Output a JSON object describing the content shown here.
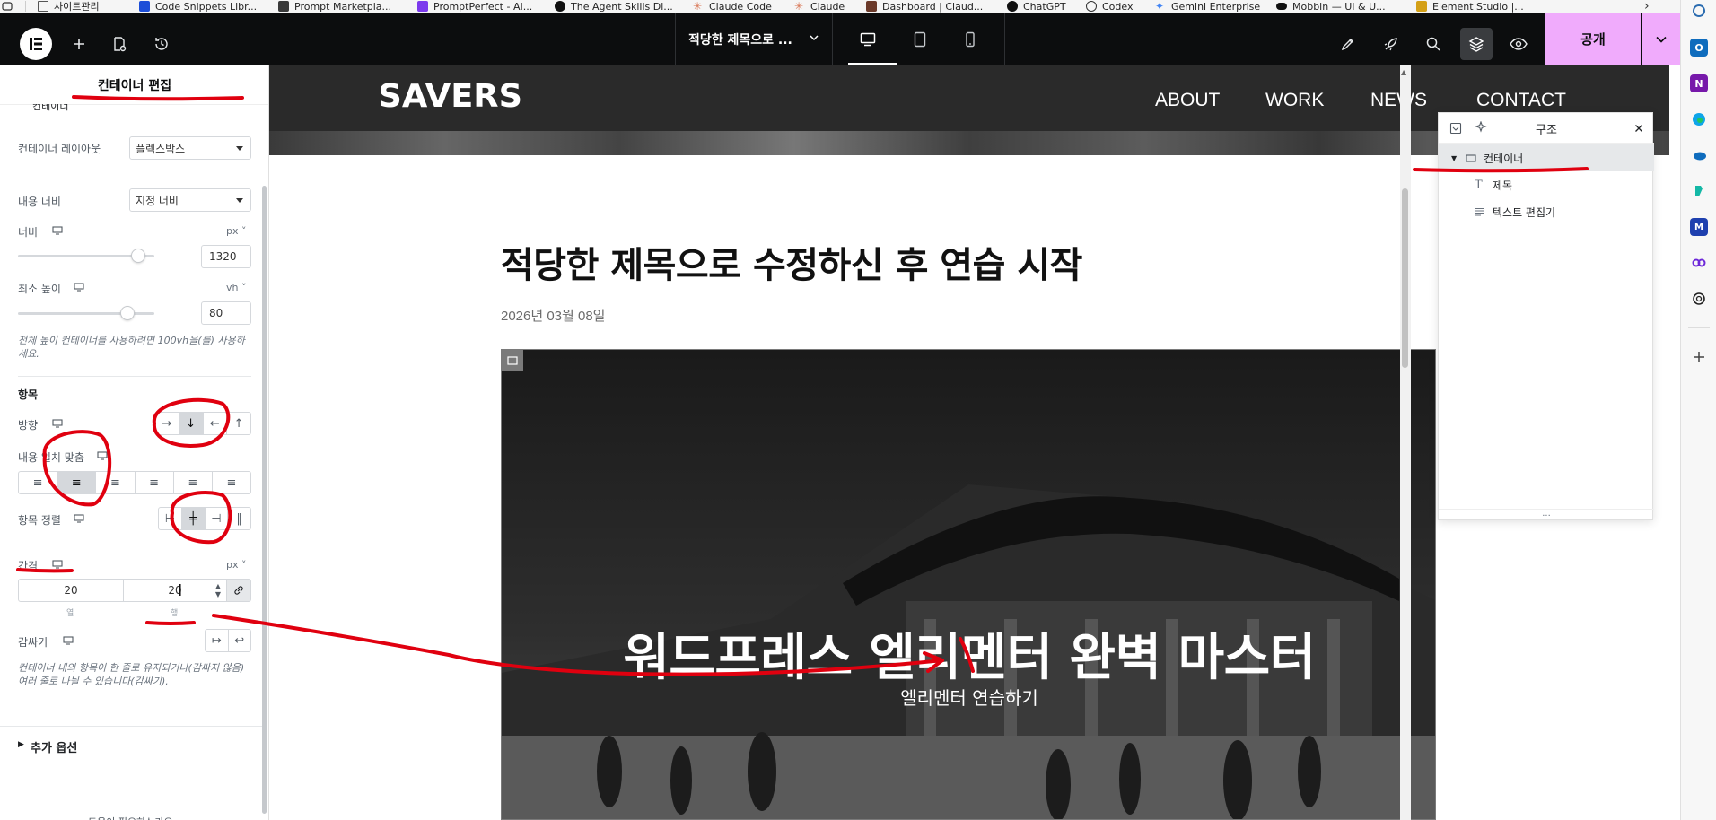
{
  "bookmarks": [
    {
      "label": "사이트관리",
      "color": "#8a8a8a"
    },
    {
      "label": "Code Snippets Libr...",
      "color": "#1d4ed8"
    },
    {
      "label": "Prompt Marketpla...",
      "color": "#3a3a3a"
    },
    {
      "label": "PromptPerfect - AI...",
      "color": "#7c3aed"
    },
    {
      "label": "The Agent Skills Di...",
      "color": "#111111"
    },
    {
      "label": "Claude Code",
      "color": "#d97757"
    },
    {
      "label": "Claude",
      "color": "#d97757"
    },
    {
      "label": "Dashboard | Claud...",
      "color": "#6b3a2a"
    },
    {
      "label": "ChatGPT",
      "color": "#111111"
    },
    {
      "label": "Codex",
      "color": "#333333"
    },
    {
      "label": "Gemini Enterprise",
      "color": "#4285f4"
    },
    {
      "label": "Mobbin — UI & U...",
      "color": "#111111"
    },
    {
      "label": "Element Studio |...",
      "color": "#d4a017"
    }
  ],
  "topbar": {
    "doc_title": "적당한 제목으로 ...",
    "publish_label": "공개"
  },
  "panel": {
    "header": "컨테이너 편집",
    "partial_top": "컨테이너",
    "layout_label": "컨테이너 레이아웃",
    "layout_value": "플렉스박스",
    "content_width_label": "내용 너비",
    "content_width_value": "지정 너비",
    "width_label": "너비",
    "width_unit": "px",
    "width_value": "1320",
    "width_fraction": 0.88,
    "min_height_label": "최소 높이",
    "min_height_unit": "vh",
    "min_height_value": "80",
    "min_height_fraction": 0.8,
    "min_height_hint": "전체 높이 컨테이너를 사용하려면 100vh을(를) 사용하세요.",
    "items_title": "항목",
    "direction_label": "방향",
    "justify_label": "내용 일치 맞춤",
    "align_label": "항목 정렬",
    "gap_label": "간격",
    "gap_unit": "px",
    "gap_column": "20",
    "gap_row": "20",
    "gap_column_caption": "열",
    "gap_row_caption": "행",
    "wrap_label": "감싸기",
    "wrap_hint": "컨테이너 내의 항목이 한 줄로 유지되거나(감싸지 않음) 여러 줄로 나뉠 수 있습니다(감싸기).",
    "more_options": "추가 옵션",
    "bottom_partial": "도움이 필요하신가요"
  },
  "site": {
    "logo": "SAVERS",
    "nav": [
      "ABOUT",
      "WORK",
      "NEWS",
      "CONTACT"
    ],
    "post_title": "적당한 제목으로 수정하신 후 연습 시작",
    "post_date": "2026년 03월 08일",
    "hero_title": "워드프레스 엘리멘터 완벽 마스터",
    "hero_subtitle": "엘리멘터 연습하기"
  },
  "structure": {
    "title": "구조",
    "items": [
      {
        "label": "컨테이너",
        "selected": true
      },
      {
        "label": "제목",
        "selected": false
      },
      {
        "label": "텍스트 편집기",
        "selected": false
      }
    ],
    "footer": "..."
  },
  "colors": {
    "accent_publish": "#f0abfc",
    "annotation_red": "#e0000f",
    "topbar_bg": "#0c0d0e"
  }
}
